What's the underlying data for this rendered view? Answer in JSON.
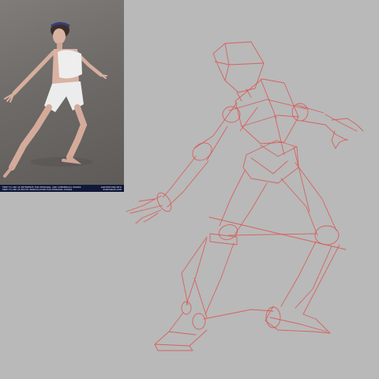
{
  "reference_photo": {
    "footer_left": [
      "FREE TO USE AS REFERENCE FOR PERSONAL AND COMMERCIAL WORKS",
      "FREE TO USE AS PHOTO MANIPULATION FOR PERSONAL WORKS"
    ],
    "footer_right": [
      "ANATOMY360.INFO",
      "POSESPACE.COM"
    ]
  },
  "colors": {
    "canvas_bg": "#b9b9b9",
    "sketch_stroke": "#d9534f",
    "footer_bg": "#10183a"
  }
}
